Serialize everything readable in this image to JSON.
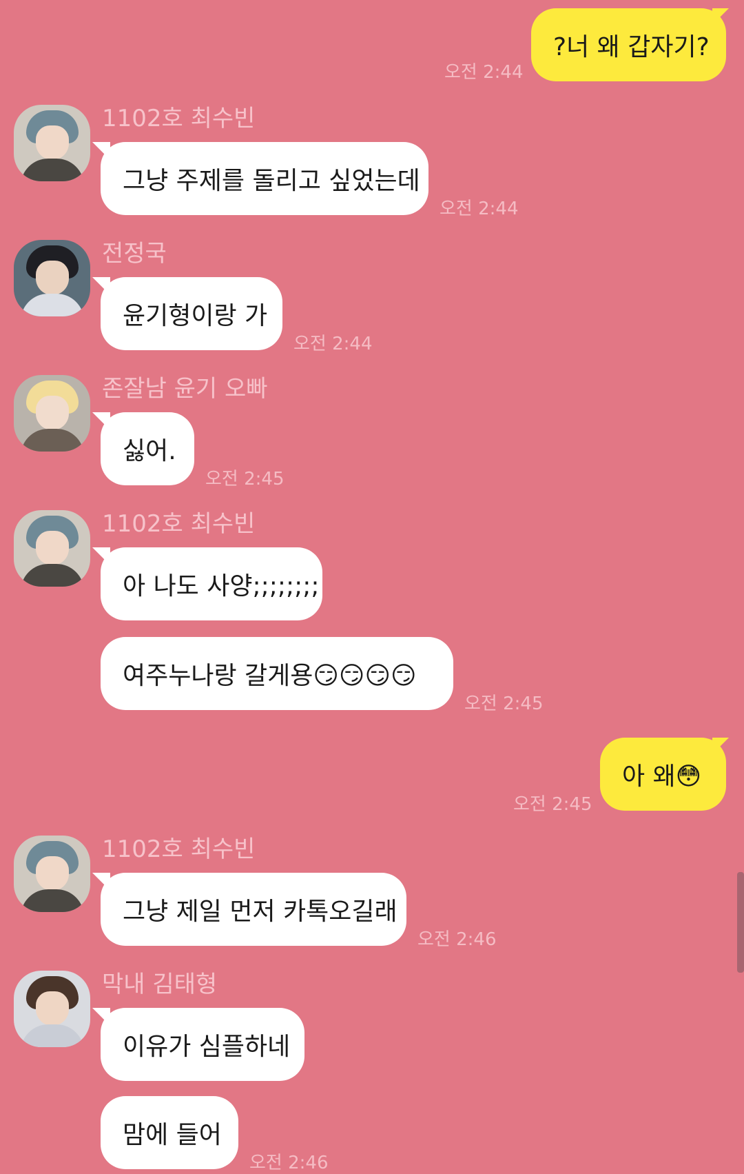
{
  "messages": [
    {
      "dir": "out",
      "text": "?너 왜 갑자기?",
      "time": "오전 2:44"
    },
    {
      "dir": "in",
      "sender": "1102호 최수빈",
      "avatar": "avatar-gray-hair",
      "text": "그냥 주제를 돌리고 싶었는데",
      "time": "오전 2:44"
    },
    {
      "dir": "in",
      "sender": "전정국",
      "avatar": "avatar-dark-hair",
      "text": "윤기형이랑 가",
      "time": "오전 2:44"
    },
    {
      "dir": "in",
      "sender": "존잘남 윤기 오빠",
      "avatar": "avatar-blonde-hair",
      "text": "싫어.",
      "time": "오전 2:45"
    },
    {
      "dir": "in",
      "sender": "1102호 최수빈",
      "avatar": "avatar-gray-hair",
      "text": "아 나도 사양;;;;;;;;",
      "time": ""
    },
    {
      "dir": "in",
      "sender": "",
      "text": "여주누나랑 갈게용😏😏😏😏",
      "time": "오전 2:45"
    },
    {
      "dir": "out",
      "text": "아 왜😳",
      "time": "오전 2:45"
    },
    {
      "dir": "in",
      "sender": "1102호 최수빈",
      "avatar": "avatar-gray-hair",
      "text": "그냥 제일 먼저 카톡오길래",
      "time": "오전 2:46"
    },
    {
      "dir": "in",
      "sender": "막내 김태형",
      "avatar": "avatar-brown-hair",
      "text": "이유가 심플하네",
      "time": ""
    },
    {
      "dir": "in",
      "sender": "",
      "text": "맘에 들어",
      "time": "오전 2:46"
    }
  ],
  "colors": {
    "background": "#e27785",
    "incoming_bubble": "#ffffff",
    "outgoing_bubble": "#fdea3d",
    "sender_name": "#f7c2ca",
    "timestamp": "#f5bcc4"
  }
}
